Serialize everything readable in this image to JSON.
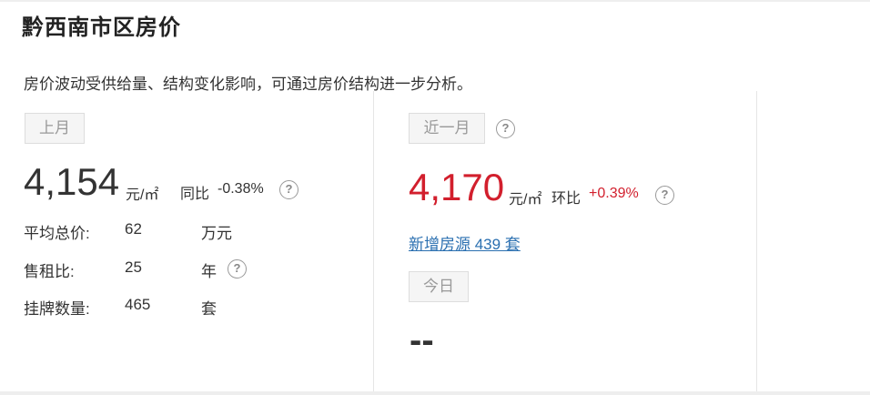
{
  "page": {
    "title": "黔西南市区房价",
    "subtitle": "房价波动受供给量、结构变化影响，可通过房价结构进一步分析。"
  },
  "last_month": {
    "tag": "上月",
    "price": "4,154",
    "unit": "元/㎡",
    "yoy_label": "同比",
    "yoy_value": "-0.38%",
    "help_icon": "?",
    "rows": [
      {
        "label": "平均总价:",
        "value": "62",
        "unit": "万元"
      },
      {
        "label": "售租比:",
        "value": "25",
        "unit": "年"
      },
      {
        "label": "挂牌数量:",
        "value": "465",
        "unit": "套"
      }
    ]
  },
  "recent_month": {
    "tag": "近一月",
    "help_icon": "?",
    "price": "4,170",
    "unit": "元/㎡",
    "mom_label": "环比",
    "mom_value": "+0.39%",
    "new_listings": "新增房源 439 套"
  },
  "today": {
    "tag": "今日",
    "value": "--"
  },
  "colors": {
    "accent_red": "#d21f2d",
    "link_blue": "#2a6fb0",
    "icon": "question-circle-icon"
  }
}
